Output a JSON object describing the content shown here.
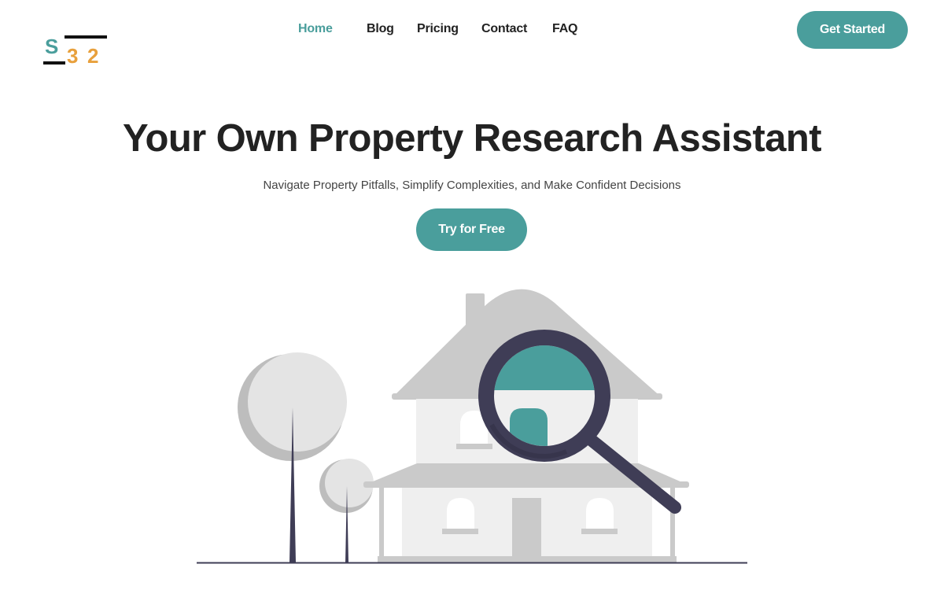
{
  "header": {
    "logo": {
      "letters": [
        "S",
        "3",
        "2"
      ],
      "alt": "S32 logo"
    },
    "nav": [
      {
        "label": "Home",
        "active": true
      },
      {
        "label": "Blog",
        "active": false
      },
      {
        "label": "Pricing",
        "active": false
      },
      {
        "label": "Contact",
        "active": false
      },
      {
        "label": "FAQ",
        "active": false
      }
    ],
    "cta_label": "Get Started"
  },
  "hero": {
    "title": "Your Own Property Research Assistant",
    "subtitle": "Navigate Property Pitfalls, Simplify Complexities, and Make Confident Decisions",
    "cta_label": "Try for Free"
  },
  "illustration": {
    "subject": "house-with-magnifying-glass",
    "elements": [
      "tree-large",
      "tree-small",
      "house",
      "magnifying-glass",
      "ground-line"
    ]
  },
  "colors": {
    "brand_teal": "#4a9e9c",
    "brand_orange": "#e8a03c",
    "dark_ink": "#3f3d56",
    "text_dark": "#222222",
    "roof_gray": "#cacaca",
    "wall_light": "#efefef"
  }
}
